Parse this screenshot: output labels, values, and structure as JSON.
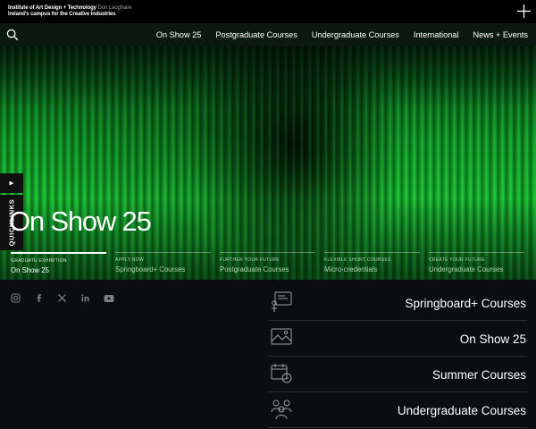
{
  "header": {
    "logo_line1_strong": "Institute of Art Design + Technology",
    "logo_line1_muted": "Dún Laoghaire",
    "logo_line2": "Ireland's campus for the Creative Industries",
    "menu_icon": "plus-icon"
  },
  "nav": {
    "search_icon": "search-icon",
    "items": [
      {
        "label": "On Show 25"
      },
      {
        "label": "Postgraduate Courses"
      },
      {
        "label": "Undergraduate Courses"
      },
      {
        "label": "International"
      },
      {
        "label": "News + Events"
      }
    ]
  },
  "hero": {
    "title": "On Show 25",
    "quicklinks_label": "QUICKLINKS",
    "play_icon": "play-icon",
    "cards": [
      {
        "eyebrow": "GRADUATE EXHIBITION",
        "label": "On Show 25"
      },
      {
        "eyebrow": "APPLY NOW",
        "label": "Springboard+ Courses"
      },
      {
        "eyebrow": "FURTHER YOUR FUTURE",
        "label": "Postgraduate Courses"
      },
      {
        "eyebrow": "FLEXIBLE SHORT COURSES",
        "label": "Micro-credentials"
      },
      {
        "eyebrow": "CREATE YOUR FUTURE",
        "label": "Undergraduate Courses"
      }
    ],
    "colors": {
      "green": "#19c734",
      "dark_green": "#064d16"
    }
  },
  "social": [
    "instagram-icon",
    "facebook-icon",
    "x-icon",
    "linkedin-icon",
    "youtube-icon"
  ],
  "links": [
    {
      "icon": "presentation-icon",
      "label": "Springboard+ Courses"
    },
    {
      "icon": "image-icon",
      "label": "On Show 25"
    },
    {
      "icon": "calendar-icon",
      "label": "Summer Courses"
    },
    {
      "icon": "people-icon",
      "label": "Undergraduate Courses"
    }
  ]
}
